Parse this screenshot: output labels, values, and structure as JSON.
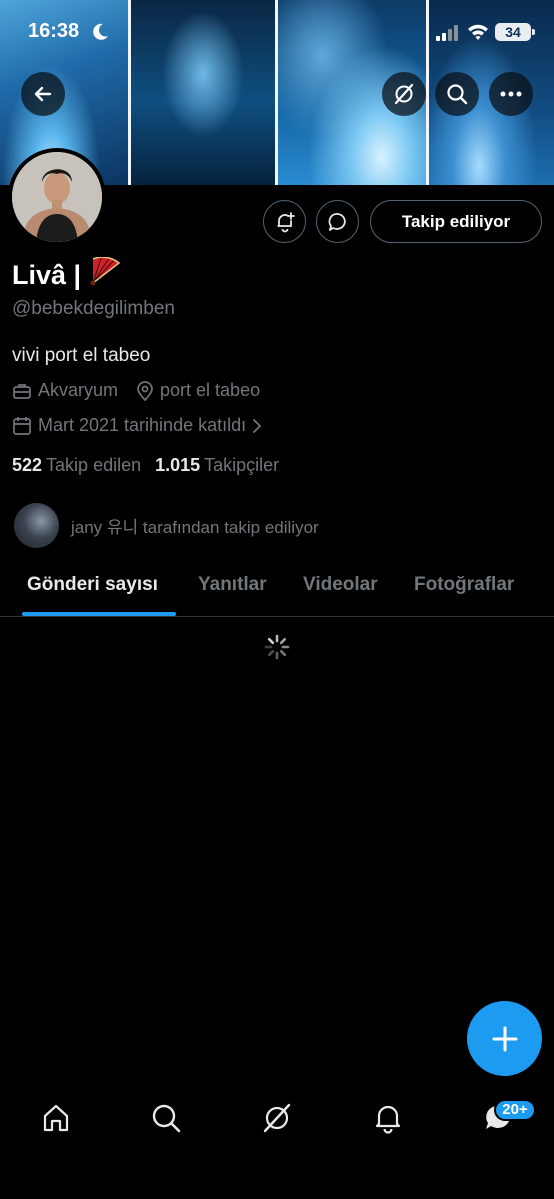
{
  "status_bar": {
    "time": "16:38",
    "battery": "34"
  },
  "profile": {
    "name": "Livâ |",
    "handle": "@bebekdegilimben",
    "bio": "vivi port el tabeo",
    "category": "Akvaryum",
    "location": "port el tabeo",
    "joined": "Mart 2021 tarihinde katıldı",
    "following_count": "522",
    "following_label": "Takip edilen",
    "followers_count": "1.015",
    "followers_label": "Takipçiler",
    "followed_by": "jany 유니 tarafından takip ediliyor"
  },
  "actions": {
    "follow_label": "Takip ediliyor"
  },
  "tabs": [
    {
      "label": "Gönderi sayısı",
      "active": true
    },
    {
      "label": "Yanıtlar",
      "active": false
    },
    {
      "label": "Videolar",
      "active": false
    },
    {
      "label": "Fotoğraflar",
      "active": false
    }
  ],
  "bottom_nav": {
    "items": [
      "home-icon",
      "search-icon",
      "grok-icon",
      "bell-icon",
      "messages-icon"
    ],
    "messages_badge": "20+"
  },
  "colors": {
    "accent": "#1d9bf0",
    "muted": "#71767b",
    "text": "#e7e9ea"
  }
}
